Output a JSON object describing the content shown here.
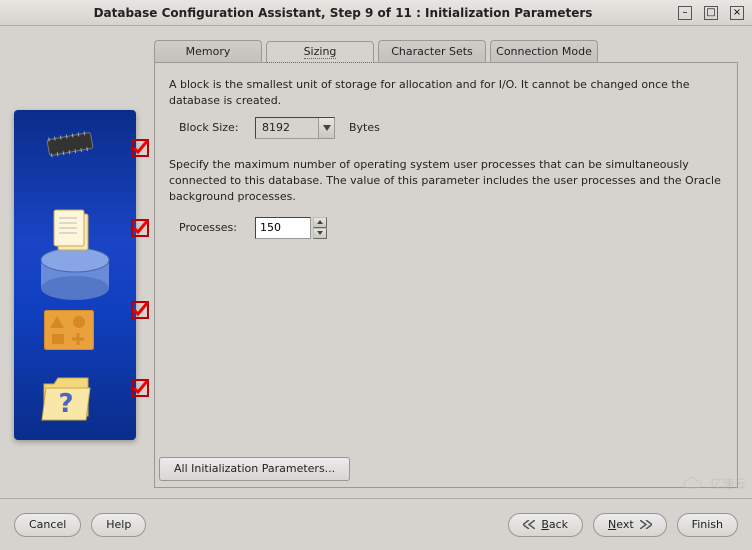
{
  "window": {
    "title": "Database Configuration Assistant, Step 9 of 11 : Initialization Parameters"
  },
  "tabs": {
    "memory": "Memory",
    "sizing": "Sizing",
    "charset": "Character Sets",
    "connmode": "Connection Mode"
  },
  "panel": {
    "block_desc": "A block is the smallest unit of storage for allocation and for I/O. It cannot be changed once the database is created.",
    "block_size_label": "Block Size:",
    "block_size_value": "8192",
    "block_size_unit": "Bytes",
    "proc_desc": "Specify the maximum number of operating system user processes that can be simultaneously connected to this database. The value of this parameter includes the user processes and the Oracle background processes.",
    "processes_label": "Processes:",
    "processes_value": "150",
    "all_params": "All Initialization Parameters..."
  },
  "footer": {
    "cancel": "Cancel",
    "help": "Help",
    "back": "Back",
    "next": "Next",
    "finish": "Finish"
  },
  "watermark": "亿速云"
}
